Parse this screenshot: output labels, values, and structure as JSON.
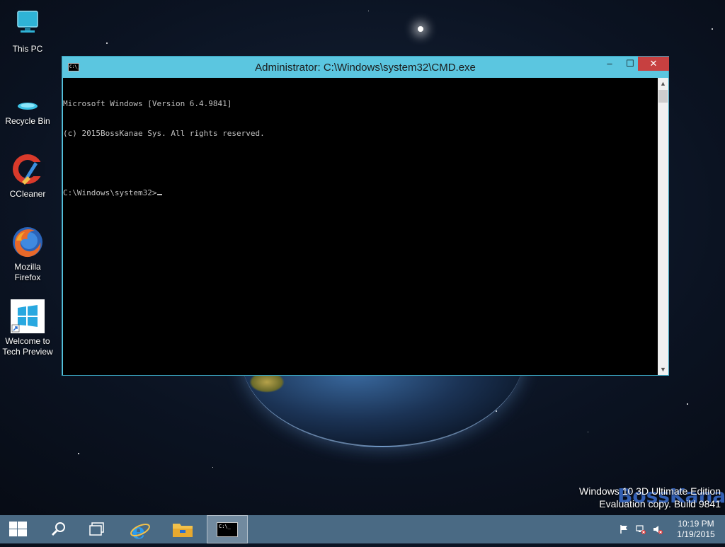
{
  "desktop": {
    "icons": [
      {
        "label": "This PC",
        "icon": "computer-icon"
      },
      {
        "label": "Recycle Bin",
        "icon": "recycle-bin-icon"
      },
      {
        "label": "CCleaner",
        "icon": "ccleaner-icon"
      },
      {
        "label": "Mozilla\nFirefox",
        "icon": "firefox-icon"
      },
      {
        "label": "Welcome to\nTech Preview",
        "icon": "windows-icon"
      }
    ],
    "watermark": {
      "line1": "Windows 10 3D Ultimate Edition",
      "line2": "Evaluation copy. Build 9841",
      "brand": "BossKana"
    }
  },
  "window": {
    "title": "Administrator: C:\\Windows\\system32\\CMD.exe",
    "icon_text": "C:\\_",
    "controls": {
      "minimize": "–",
      "maximize": "☐",
      "close": "✕"
    },
    "console_lines": [
      "Microsoft Windows [Version 6.4.9841]",
      "(c) 2015BossKanae Sys. All rights reserved.",
      "",
      "C:\\Windows\\system32>"
    ]
  },
  "taskbar": {
    "buttons": [
      "start-icon",
      "search-icon",
      "task-view-icon",
      "internet-explorer-icon",
      "file-explorer-icon",
      "cmd-icon"
    ],
    "cmd_icon_text": "C:\\_",
    "tray": [
      "flag-icon",
      "network-icon",
      "volume-muted-icon"
    ],
    "time": "10:19 PM",
    "date": "1/19/2015"
  },
  "colors": {
    "title_bar": "#5bc6e0",
    "close_button": "#c74040",
    "taskbar": "#4a6a84",
    "console_bg": "#000000",
    "console_text": "#c0c0c0"
  }
}
